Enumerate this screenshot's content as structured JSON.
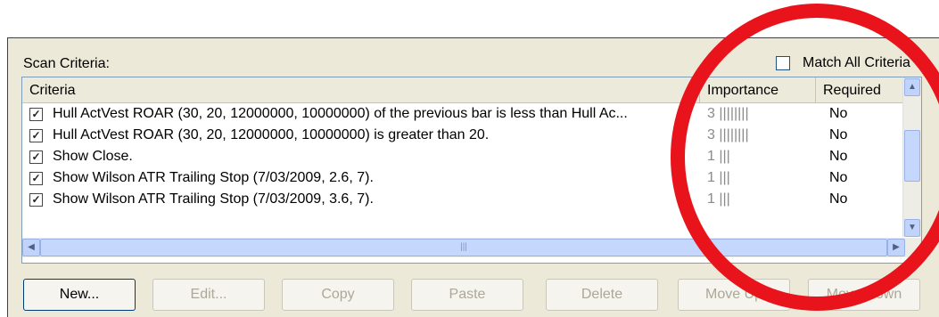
{
  "scan_criteria_label": "Scan Criteria:",
  "match_all": {
    "label": "Match All Criteria",
    "checked": false
  },
  "columns": [
    "Criteria",
    "Importance",
    "Required"
  ],
  "rows": [
    {
      "checked": true,
      "criteria": "Hull ActVest ROAR (30, 20, 12000000, 10000000) of the previous bar is less than Hull Ac...",
      "importance": "3 ||||||||",
      "required": "No"
    },
    {
      "checked": true,
      "criteria": "Hull ActVest ROAR (30, 20, 12000000, 10000000) is greater than 20.",
      "importance": "3 ||||||||",
      "required": "No"
    },
    {
      "checked": true,
      "criteria": "Show Close.",
      "importance": "1 |||",
      "required": "No"
    },
    {
      "checked": true,
      "criteria": "Show Wilson ATR Trailing Stop (7/03/2009, 2.6, 7).",
      "importance": "1 |||",
      "required": "No"
    },
    {
      "checked": true,
      "criteria": "Show Wilson ATR Trailing Stop (7/03/2009, 3.6, 7).",
      "importance": "1 |||",
      "required": "No"
    }
  ],
  "buttons": {
    "new": "New...",
    "edit": "Edit...",
    "copy": "Copy",
    "paste": "Paste",
    "delete": "Delete",
    "move_up": "Move Up",
    "move_down": "Move Down"
  },
  "annotation_color": "#e8131b"
}
